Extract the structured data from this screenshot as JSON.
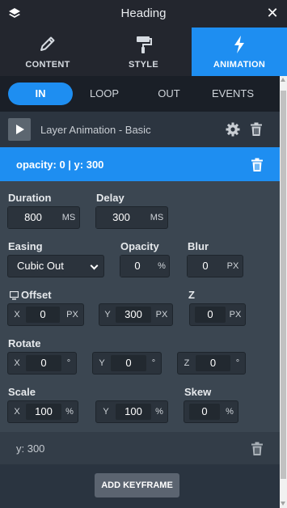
{
  "header": {
    "title": "Heading",
    "close": "✕",
    "icon": "layers-icon"
  },
  "main_tabs": [
    {
      "label": "CONTENT",
      "icon": "pencil-icon",
      "active": false
    },
    {
      "label": "STYLE",
      "icon": "paint-roller-icon",
      "active": false
    },
    {
      "label": "ANIMATION",
      "icon": "bolt-icon",
      "active": true
    }
  ],
  "sub_tabs": [
    {
      "label": "IN",
      "active": true
    },
    {
      "label": "LOOP",
      "active": false
    },
    {
      "label": "OUT",
      "active": false
    },
    {
      "label": "EVENTS",
      "active": false
    }
  ],
  "layer": {
    "name": "Layer Animation - Basic"
  },
  "keyframes": [
    {
      "summary": "opacity: 0 | y: 300",
      "expanded": true
    },
    {
      "summary": "y: 300",
      "expanded": false
    }
  ],
  "fields": {
    "duration": {
      "label": "Duration",
      "value": "800",
      "unit": "MS"
    },
    "delay": {
      "label": "Delay",
      "value": "300",
      "unit": "MS"
    },
    "easing": {
      "label": "Easing",
      "value": "Cubic Out"
    },
    "opacity": {
      "label": "Opacity",
      "value": "0",
      "unit": "%"
    },
    "blur": {
      "label": "Blur",
      "value": "0",
      "unit": "PX"
    },
    "offset": {
      "label": "Offset",
      "x": "0",
      "y": "300",
      "x_prefix": "X",
      "y_prefix": "Y",
      "unit": "PX"
    },
    "z": {
      "label": "Z",
      "value": "0",
      "unit": "PX"
    },
    "rotate": {
      "label": "Rotate",
      "x": "0",
      "y": "0",
      "z": "0",
      "x_prefix": "X",
      "y_prefix": "Y",
      "z_prefix": "Z",
      "unit": "°"
    },
    "scale": {
      "label": "Scale",
      "x": "100",
      "y": "100",
      "x_prefix": "X",
      "y_prefix": "Y",
      "unit": "%"
    },
    "skew": {
      "label": "Skew",
      "value": "0",
      "unit": "%"
    }
  },
  "add_keyframe_label": "ADD KEYFRAME",
  "colors": {
    "accent": "#1e8ef1",
    "panel": "#3b4651",
    "dark": "#23262e"
  }
}
